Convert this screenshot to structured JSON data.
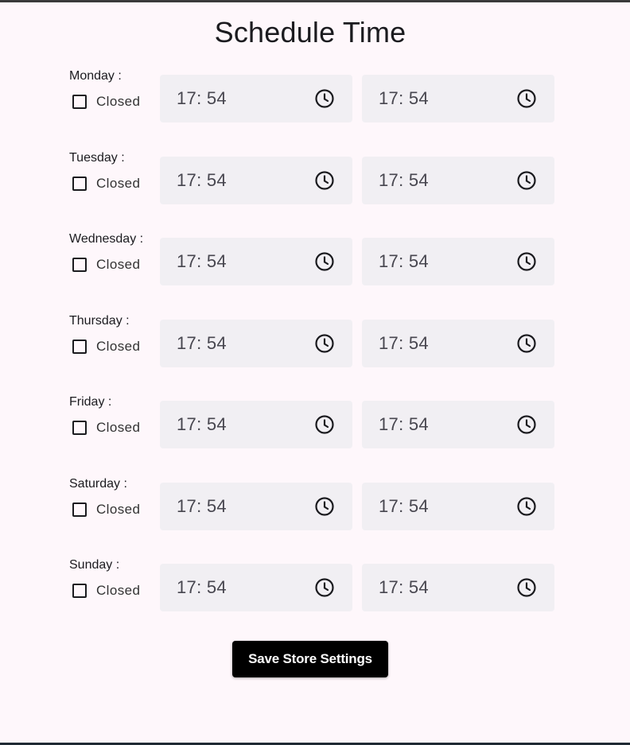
{
  "page": {
    "title": "Schedule Time"
  },
  "days": [
    {
      "label": "Monday :",
      "closed_label": "Closed",
      "closed": false,
      "open_time": "17: 54",
      "close_time": "17: 54"
    },
    {
      "label": "Tuesday :",
      "closed_label": "Closed",
      "closed": false,
      "open_time": "17: 54",
      "close_time": "17: 54"
    },
    {
      "label": "Wednesday :",
      "closed_label": "Closed",
      "closed": false,
      "open_time": "17: 54",
      "close_time": "17: 54"
    },
    {
      "label": "Thursday :",
      "closed_label": "Closed",
      "closed": false,
      "open_time": "17: 54",
      "close_time": "17: 54"
    },
    {
      "label": "Friday :",
      "closed_label": "Closed",
      "closed": false,
      "open_time": "17: 54",
      "close_time": "17: 54"
    },
    {
      "label": "Saturday :",
      "closed_label": "Closed",
      "closed": false,
      "open_time": "17: 54",
      "close_time": "17: 54"
    },
    {
      "label": "Sunday :",
      "closed_label": "Closed",
      "closed": false,
      "open_time": "17: 54",
      "close_time": "17: 54"
    }
  ],
  "actions": {
    "save_label": "Save Store Settings"
  },
  "icons": {
    "time_field_icon": "clock-icon",
    "closed_toggle": "checkbox-unchecked"
  },
  "colors": {
    "background": "#fef7fb",
    "field_background": "#f1eff3",
    "text": "#1b1b1f",
    "button_background": "#000000",
    "button_text": "#ffffff"
  }
}
